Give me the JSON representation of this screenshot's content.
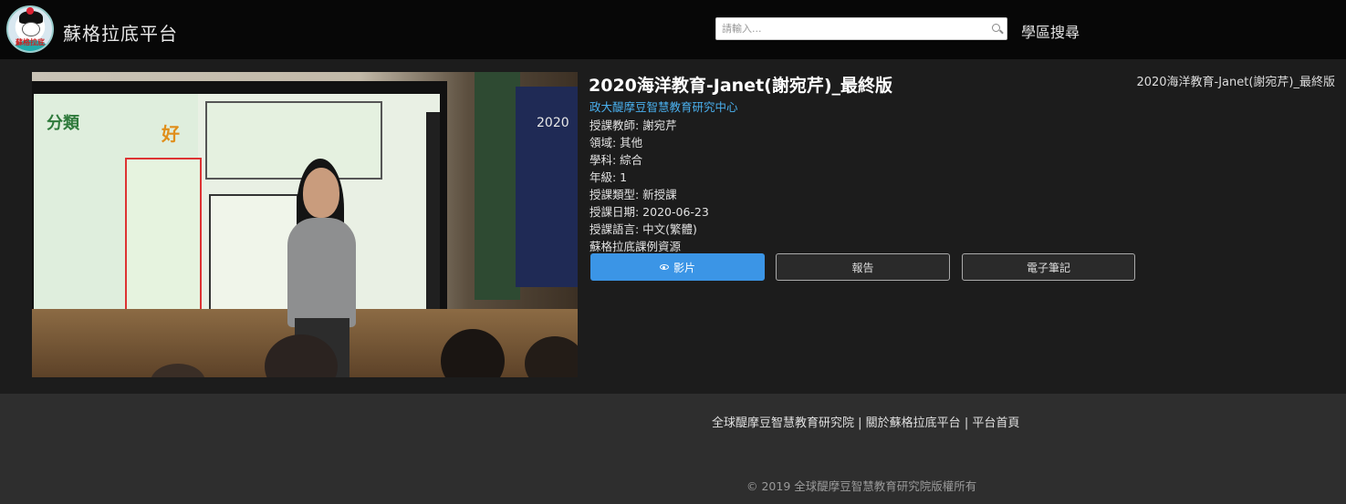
{
  "header": {
    "logo_text": "蘇格拉底",
    "site_title": "蘇格拉底平台",
    "search_placeholder": "請輸入...",
    "district_search": "學區搜尋"
  },
  "video": {
    "screen_title_1": "分類",
    "screen_title_2": "好",
    "poster_year": "2020"
  },
  "lesson": {
    "title": "2020海洋教育-Janet(謝宛芹)_最終版",
    "title_right": "2020海洋教育-Janet(謝宛芹)_最終版",
    "organization": "政大醍摩豆智慧教育研究中心",
    "teacher": "授課教師: 謝宛芹",
    "domain": "領域: 其他",
    "subject": "學科: 綜合",
    "grade": "年級: 1",
    "type": "授課類型: 新授課",
    "date": "授課日期: 2020-06-23",
    "language": "授課語言: 中文(繁體)",
    "resource": "蘇格拉底課例資源"
  },
  "buttons": {
    "video": "影片",
    "report": "報告",
    "notes": "電子筆記"
  },
  "footer": {
    "link_institute": "全球醍摩豆智慧教育研究院",
    "separator": " | ",
    "link_about": "關於蘇格拉底平台",
    "link_home": "平台首頁",
    "copyright": "© 2019 全球醍摩豆智慧教育研究院版權所有"
  },
  "colors": {
    "header_bg": "#070707",
    "main_bg": "#1c1c1c",
    "footer_bg": "#2e2e2e",
    "primary_button": "#3b95e6",
    "link": "#4ab0ee"
  }
}
